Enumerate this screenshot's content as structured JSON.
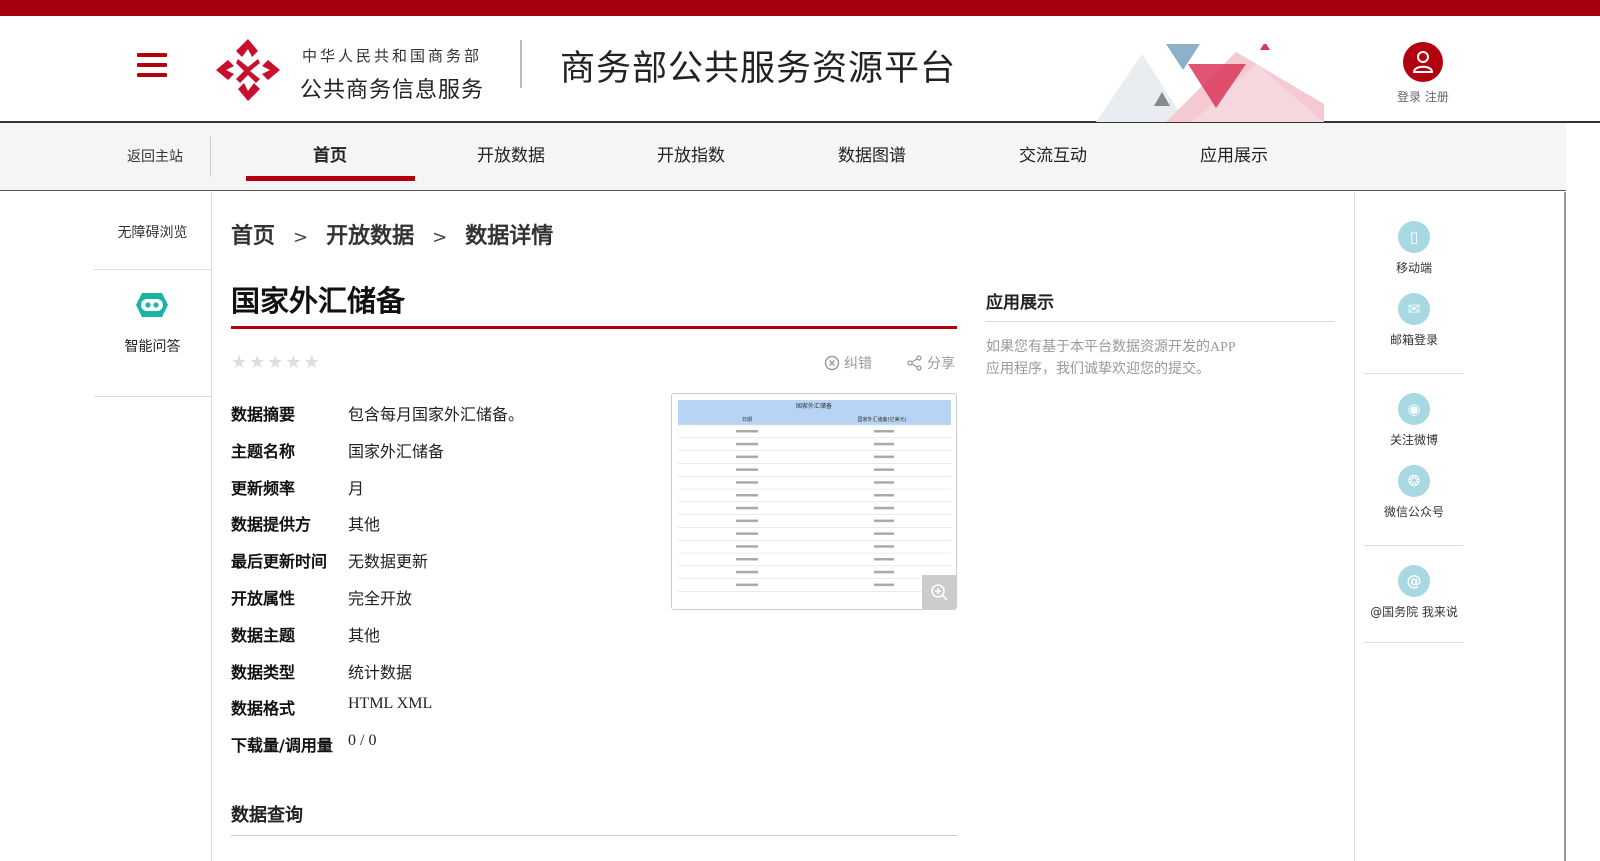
{
  "header": {
    "logo_line1": "中华人民共和国商务部",
    "logo_line2": "公共商务信息服务",
    "platform_title": "商务部公共服务资源平台",
    "login_label": "登录",
    "register_label": "注册",
    "menu_icon": "hamburger-icon",
    "user_icon": "user-icon",
    "brand_color": "#b3000f"
  },
  "nav": {
    "back_label": "返回主站",
    "items": [
      {
        "label": "首页",
        "active": true
      },
      {
        "label": "开放数据",
        "active": false
      },
      {
        "label": "开放指数",
        "active": false
      },
      {
        "label": "数据图谱",
        "active": false
      },
      {
        "label": "交流互动",
        "active": false
      },
      {
        "label": "应用展示",
        "active": false
      }
    ]
  },
  "left_sidebar": {
    "accessible_label": "无障碍浏览",
    "qa_label": "智能问答",
    "qa_icon": "robot-icon"
  },
  "breadcrumb": [
    "首页",
    "开放数据",
    "数据详情"
  ],
  "breadcrumb_sep": ">",
  "dataset": {
    "title": "国家外汇储备",
    "rating": 0,
    "rating_max": 5,
    "report_label": "纠错",
    "share_label": "分享",
    "fields": [
      {
        "key": "数据摘要",
        "value": "包含每月国家外汇储备。"
      },
      {
        "key": "主题名称",
        "value": "国家外汇储备"
      },
      {
        "key": "更新频率",
        "value": "月"
      },
      {
        "key": "数据提供方",
        "value": "其他"
      },
      {
        "key": "最后更新时间",
        "value": "无数据更新"
      },
      {
        "key": "开放属性",
        "value": "完全开放"
      },
      {
        "key": "数据主题",
        "value": "其他"
      },
      {
        "key": "数据类型",
        "value": "统计数据"
      },
      {
        "key": "数据格式",
        "value": "HTML XML"
      },
      {
        "key": "下载量/调用量",
        "value": "0 / 0"
      }
    ]
  },
  "thumbnail": {
    "title": "国家外汇储备",
    "col1": "日期",
    "col2": "国家外汇储备(亿美元)",
    "zoom_icon": "zoom-in-icon"
  },
  "query": {
    "title": "数据查询"
  },
  "app_showcase": {
    "title": "应用展示",
    "text": "如果您有基于本平台数据资源开发的APP应用程序，我们诚挚欢迎您的提交。"
  },
  "right_sidebar": {
    "items": [
      {
        "label": "移动端",
        "icon": "mobile-icon"
      },
      {
        "label": "邮箱登录",
        "icon": "mail-icon"
      },
      {
        "label": "关注微博",
        "icon": "weibo-icon"
      },
      {
        "label": "微信公众号",
        "icon": "wechat-icon"
      },
      {
        "label": "@国务院 我来说",
        "icon": "at-icon"
      }
    ]
  }
}
